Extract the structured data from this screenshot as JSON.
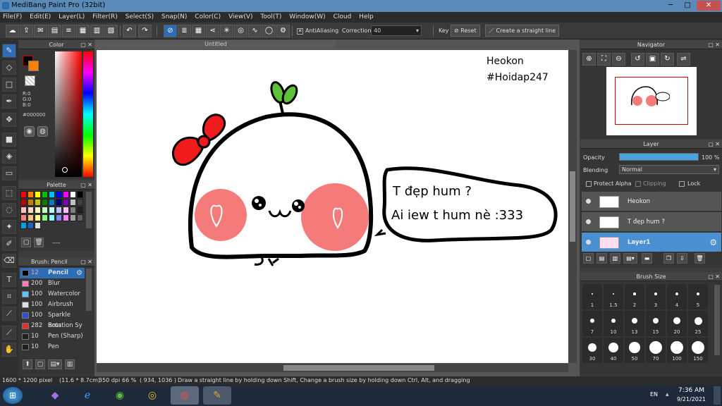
{
  "window": {
    "title": "MediBang Paint Pro (32bit)",
    "min": "─",
    "max": "□",
    "close": "✕"
  },
  "menu": [
    "File(F)",
    "Edit(E)",
    "Layer(L)",
    "Filter(R)",
    "Select(S)",
    "Snap(N)",
    "Color(C)",
    "View(V)",
    "Tool(T)",
    "Window(W)",
    "Cloud",
    "Help"
  ],
  "toolbar": {
    "antialiasing_label": "AntiAliasing",
    "correction_label": "Correction",
    "correction_value": "40",
    "key_label": "Key",
    "reset_label": "Reset",
    "straight_line_label": "Create a straight line"
  },
  "color_panel": {
    "title": "Color",
    "r": "R:0",
    "g": "G:0",
    "b": "B:0",
    "hex": "#000000",
    "primary": "#000000",
    "secondary": "#ff8000"
  },
  "palette_panel": {
    "title": "Palette",
    "footer": "----",
    "swatches": [
      "#ff0000",
      "#ff8000",
      "#ffff00",
      "#00c000",
      "#00c0ff",
      "#0000ff",
      "#ff00ff",
      "#ffffff",
      "#000000",
      "#c00000",
      "#c08000",
      "#c0c000",
      "#008000",
      "#0080c0",
      "#000080",
      "#8000c0",
      "#c0c0c0",
      "#404040",
      "#ffc0c0",
      "#ffe0c0",
      "#ffffc0",
      "#c0ffc0",
      "#c0ffff",
      "#c0c0ff",
      "#ffc0ff",
      "#808080",
      "#202020",
      "#ff8080",
      "#ffc080",
      "#ffff80",
      "#80ff80",
      "#80ffff",
      "#8080ff",
      "#ff80ff",
      "#a0a0a0",
      "#606060",
      "#00a0e0",
      "#2060c0",
      "#e0e0e0"
    ]
  },
  "brush_panel": {
    "title": "Brush: Pencil",
    "items": [
      {
        "size": "12",
        "name": "Pencil",
        "color": "#000000",
        "selected": true
      },
      {
        "size": "200",
        "name": "Blur",
        "color": "#ff80c0",
        "selected": false
      },
      {
        "size": "100",
        "name": "Watercolor",
        "color": "#60c0ff",
        "selected": false
      },
      {
        "size": "100",
        "name": "Airbrush",
        "color": "#e0e0e0",
        "selected": false
      },
      {
        "size": "100",
        "name": "Sparkle Brus",
        "color": "#3050d0",
        "selected": false
      },
      {
        "size": "282",
        "name": "Rotation Sy",
        "color": "#e03030",
        "selected": false
      },
      {
        "size": "10",
        "name": "Pen (Sharp)",
        "color": "#202020",
        "selected": false
      },
      {
        "size": "10",
        "name": "Pen",
        "color": "#202020",
        "selected": false
      }
    ]
  },
  "document": {
    "tab": "Untitled"
  },
  "canvas_text": {
    "signature1": "Heokon",
    "signature2": "#Hoidap247",
    "bubble1": "T đẹp hum ?",
    "bubble2": "Ai iew t hum nè :333"
  },
  "navigator": {
    "title": "Navigator"
  },
  "layer_panel": {
    "title": "Layer",
    "opacity_label": "Opacity",
    "opacity_value": "100 %",
    "opacity": 1.0,
    "blending_label": "Blending",
    "blending_value": "Normal",
    "protect_alpha": "Protect Alpha",
    "clipping": "Clipping",
    "lock": "Lock",
    "layers": [
      {
        "name": "Heokon",
        "selected": false
      },
      {
        "name": "T đẹp hum ?",
        "selected": false
      },
      {
        "name": "Layer1",
        "selected": true
      }
    ]
  },
  "brush_size_panel": {
    "title": "Brush Size",
    "sizes": [
      "1",
      "1.5",
      "2",
      "3",
      "4",
      "5",
      "7",
      "10",
      "13",
      "15",
      "20",
      "25",
      "30",
      "40",
      "50",
      "70",
      "100",
      "150"
    ]
  },
  "status": {
    "size": "1600 * 1200 pixel",
    "cm": "(11.6 * 8.7cm)",
    "dpi": "350 dpi",
    "zoom": "66 %",
    "coords": "( 934, 1036 )",
    "hint": "Draw a straight line by holding down Shift, Change a brush size by holding down Ctrl, Alt, and dragging"
  },
  "taskbar": {
    "lang": "EN",
    "time": "7:36 AM",
    "date": "9/21/2021"
  }
}
